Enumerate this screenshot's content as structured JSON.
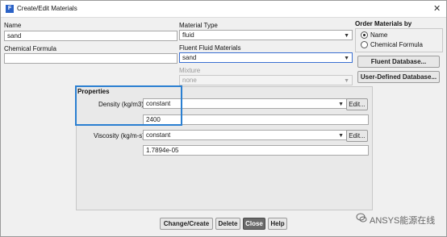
{
  "window": {
    "title": "Create/Edit Materials"
  },
  "name": {
    "label": "Name",
    "value": "sand"
  },
  "chemical_formula": {
    "label": "Chemical Formula",
    "value": ""
  },
  "material_type": {
    "label": "Material Type",
    "value": "fluid"
  },
  "fluent_fluid_materials": {
    "label": "Fluent Fluid Materials",
    "value": "sand"
  },
  "mixture": {
    "label": "Mixture",
    "value": "none"
  },
  "order_materials_by": {
    "label": "Order Materials by",
    "options": [
      "Name",
      "Chemical Formula"
    ],
    "selected": "Name"
  },
  "side_buttons": {
    "fluent_database": "Fluent Database...",
    "user_defined_database": "User-Defined Database..."
  },
  "properties": {
    "label": "Properties",
    "density": {
      "label": "Density (kg/m3)",
      "method": "constant",
      "edit": "Edit...",
      "value": "2400"
    },
    "viscosity": {
      "label": "Viscosity (kg/m-s)",
      "method": "constant",
      "edit": "Edit...",
      "value": "1.7894e-05"
    }
  },
  "buttons": {
    "change_create": "Change/Create",
    "delete": "Delete",
    "close": "Close",
    "help": "Help"
  },
  "watermark": {
    "text": "ANSYS能源在线"
  }
}
